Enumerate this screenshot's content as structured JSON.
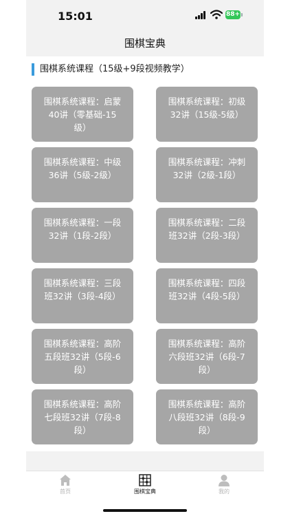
{
  "status_bar": {
    "time": "15:01",
    "battery": "88+"
  },
  "nav": {
    "title": "围棋宝典"
  },
  "section": {
    "title": "围棋系统课程（15级+9段视频教学）"
  },
  "courses": [
    {
      "label": "围棋系统课程：启蒙40讲（零基础-15级）"
    },
    {
      "label": "围棋系统课程：初级32讲（15级-5级）"
    },
    {
      "label": "围棋系统课程：中级36讲（5级-2级）"
    },
    {
      "label": "围棋系统课程：冲刺32讲（2级-1段）"
    },
    {
      "label": "围棋系统课程：一段32讲（1段-2段）"
    },
    {
      "label": "围棋系统课程：二段班32讲（2段-3段）"
    },
    {
      "label": "围棋系统课程：三段班32讲（3段-4段）"
    },
    {
      "label": "围棋系统课程：四段班32讲（4段-5段）"
    },
    {
      "label": "围棋系统课程：高阶五段班32讲（5段-6段）"
    },
    {
      "label": "围棋系统课程：高阶六段班32讲（6段-7段）"
    },
    {
      "label": "围棋系统课程：高阶七段班32讲（7段-8段）"
    },
    {
      "label": "围棋系统课程：高阶八段班32讲（8段-9段）"
    }
  ],
  "tabs": [
    {
      "label": "首页",
      "icon": "home-icon",
      "active": false
    },
    {
      "label": "围棋宝典",
      "icon": "go-board-icon",
      "active": true
    },
    {
      "label": "我的",
      "icon": "person-icon",
      "active": false
    }
  ],
  "colors": {
    "accent": "#3a9bdc",
    "card": "#a6a6a6",
    "battery": "#34c759"
  }
}
